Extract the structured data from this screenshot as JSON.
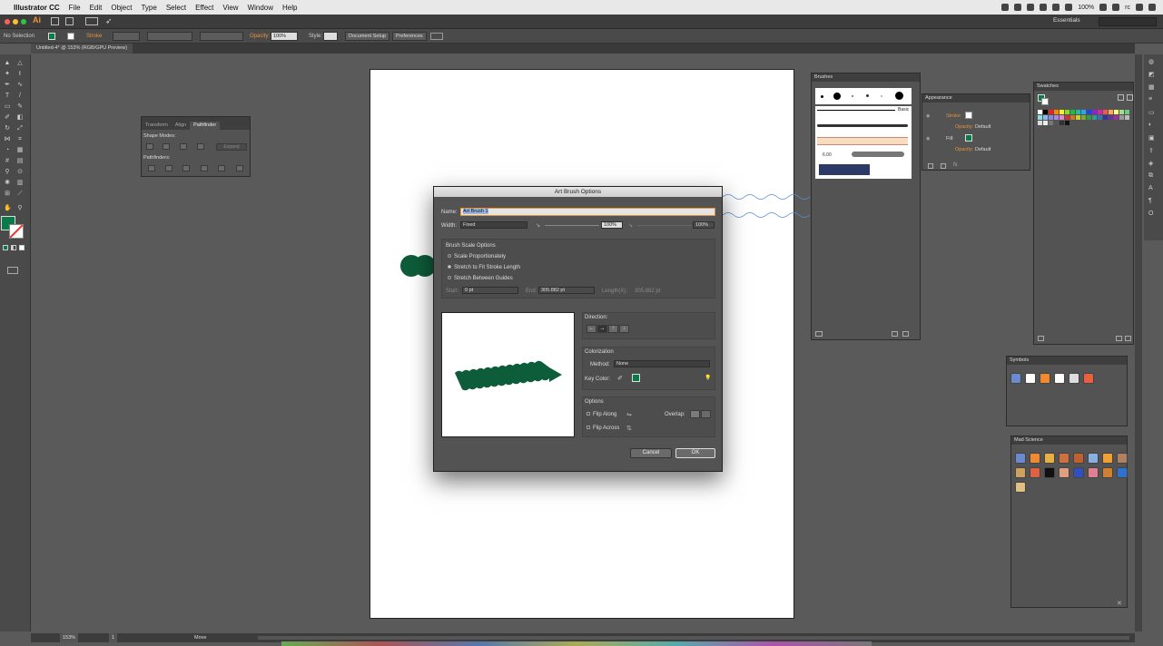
{
  "menubar": {
    "apple": "",
    "app_name": "Illustrator CC",
    "items": [
      "File",
      "Edit",
      "Object",
      "Type",
      "Select",
      "Effect",
      "View",
      "Window",
      "Help"
    ],
    "battery": "100%",
    "user": "rc"
  },
  "appbar": {
    "ai_logo": "Ai",
    "workspace": "Essentials"
  },
  "control_bar": {
    "selection": "No Selection",
    "stroke_label": "Stroke",
    "opacity_label": "Opacity:",
    "opacity_value": "100%",
    "style_label": "Style:",
    "document_setup": "Document Setup",
    "preferences": "Preferences"
  },
  "doc_tab": "Untitled-4* @ 153% (RGB/GPU Preview)",
  "pathfinder": {
    "tabs": [
      "Transform",
      "Align",
      "Pathfinder"
    ],
    "shape_modes": "Shape Modes:",
    "expand": "Expand",
    "pathfinders": "Pathfinders:"
  },
  "brushes": {
    "title": "Brushes",
    "basic": "Basic",
    "size": "6.00"
  },
  "appearance": {
    "title": "Appearance",
    "stroke": "Stroke",
    "opacity": "Opacity:",
    "default": "Default",
    "fill": "Fill:"
  },
  "swatches": {
    "title": "Swatches"
  },
  "symbols": {
    "title": "Symbols"
  },
  "mad_science": {
    "title": "Mad Science"
  },
  "dialog": {
    "title": "Art Brush Options",
    "name_label": "Name:",
    "name_value": "Art Brush 1",
    "width_label": "Width:",
    "width_value": "Fixed",
    "width_pct": "100%",
    "width_pct2": "100%",
    "scale_options_label": "Brush Scale Options",
    "opt_scale_prop": "Scale Proportionately",
    "opt_stretch_fit": "Stretch to Fit Stroke Length",
    "opt_stretch_guides": "Stretch Between Guides",
    "start_label": "Start:",
    "start_value": "0 pt",
    "end_label": "End:",
    "end_value": "305.882 pt",
    "length_label": "Length(X):",
    "length_value": "305.882 pt",
    "direction_label": "Direction:",
    "colorization_label": "Colorization",
    "method_label": "Method:",
    "method_value": "None",
    "key_color_label": "Key Color:",
    "options_label": "Options",
    "flip_along": "Flip Along",
    "flip_across": "Flip Across",
    "overlap_label": "Overlap:",
    "cancel": "Cancel",
    "ok": "OK"
  },
  "statusbar": {
    "zoom": "153%",
    "page": "1",
    "tool": "Move"
  },
  "colors": {
    "fill": "#0b7a4a",
    "brush_green": "#0d5c3a",
    "accent_orange": "#e8923a"
  }
}
